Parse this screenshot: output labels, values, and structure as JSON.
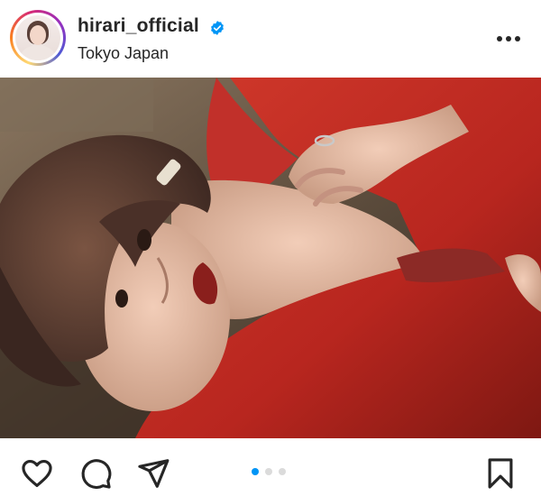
{
  "post": {
    "username": "hirari_official",
    "verified": true,
    "location": "Tokyo Japan",
    "avatar_icon": "profile-photo",
    "more_icon": "more-horizontal-icon"
  },
  "media": {
    "slide_count": 3,
    "active_slide": 1
  },
  "actions": {
    "like_icon": "heart-icon",
    "comment_icon": "comment-bubble-icon",
    "share_icon": "paper-plane-icon",
    "save_icon": "bookmark-icon"
  },
  "colors": {
    "text": "#262626",
    "verified_badge": "#0095f6",
    "active_dot": "#0095f6",
    "inactive_dot": "#dbdbdb",
    "story_ring_start": "#feda75",
    "story_ring_end": "#962fbf"
  }
}
